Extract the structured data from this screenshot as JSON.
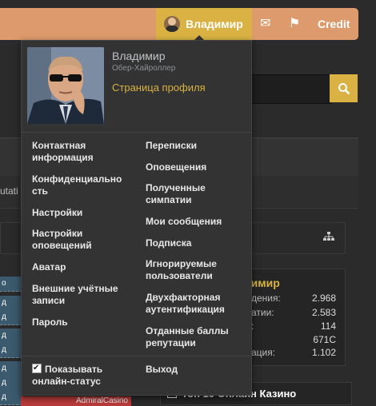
{
  "nav": {
    "username": "Владимир",
    "credit_label": "Credit",
    "icons": [
      "envelope-icon",
      "flag-icon"
    ]
  },
  "background": {
    "tab_text": "utati",
    "row_labels": [
      "о",
      "д",
      "д",
      "д",
      "д",
      "д",
      "д",
      "д"
    ],
    "stats": {
      "title": "Владимир",
      "labels": [
        "дения:",
        "атии:",
        ":",
        "",
        "ация:"
      ],
      "values": [
        "2.968",
        "2.583",
        "114",
        "671C",
        "1.102"
      ]
    },
    "top10_label": "Топ 10 Онлайн Казино",
    "admiral_label": "AdmiralCasino"
  },
  "menu": {
    "name": "Владимир",
    "title": "Обер-Хайроллер",
    "profile_link": "Страница профиля",
    "left_items": [
      "Контактная информация",
      "Конфиденциально сть",
      "Настройки",
      "Настройки оповещений",
      "Аватар",
      "Внешние учётные записи",
      "Пароль"
    ],
    "right_items": [
      "Переписки",
      "Оповещения",
      "Полученные симпатии",
      "Мои сообщения",
      "Подписка",
      "Игнорируемые пользователи",
      "Двухфакторная аутентификация",
      "Отданные баллы репутации"
    ],
    "online_status_label": "Показывать онлайн-статус",
    "online_status_checked": true,
    "logout_label": "Выход"
  },
  "colors": {
    "nav_bg": "#dd9a6c",
    "accent": "#d9b243",
    "menu_bg": "#333333"
  }
}
